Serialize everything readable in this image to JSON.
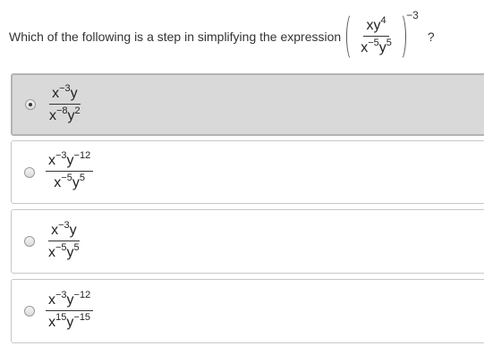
{
  "question": {
    "text": "Which of the following is a step in simplifying the expression",
    "expression": {
      "num_base": "xy",
      "num_exp": "4",
      "den_x": "x",
      "den_x_exp": "−5",
      "den_y": "y",
      "den_y_exp": "5",
      "outer_exp": "−3"
    },
    "end": "?"
  },
  "options": [
    {
      "selected": true,
      "num_a": "x",
      "num_a_exp": "−3",
      "num_b": "y",
      "num_b_exp": "",
      "den_a": "x",
      "den_a_exp": "−8",
      "den_b": "y",
      "den_b_exp": "2"
    },
    {
      "selected": false,
      "num_a": "x",
      "num_a_exp": "−3",
      "num_b": "y",
      "num_b_exp": "−12",
      "den_a": "x",
      "den_a_exp": "−5",
      "den_b": "y",
      "den_b_exp": "5"
    },
    {
      "selected": false,
      "num_a": "x",
      "num_a_exp": "−3",
      "num_b": "y",
      "num_b_exp": "",
      "den_a": "x",
      "den_a_exp": "−5",
      "den_b": "y",
      "den_b_exp": "5"
    },
    {
      "selected": false,
      "num_a": "x",
      "num_a_exp": "−3",
      "num_b": "y",
      "num_b_exp": "−12",
      "den_a": "x",
      "den_a_exp": "15",
      "den_b": "y",
      "den_b_exp": "−15"
    }
  ]
}
